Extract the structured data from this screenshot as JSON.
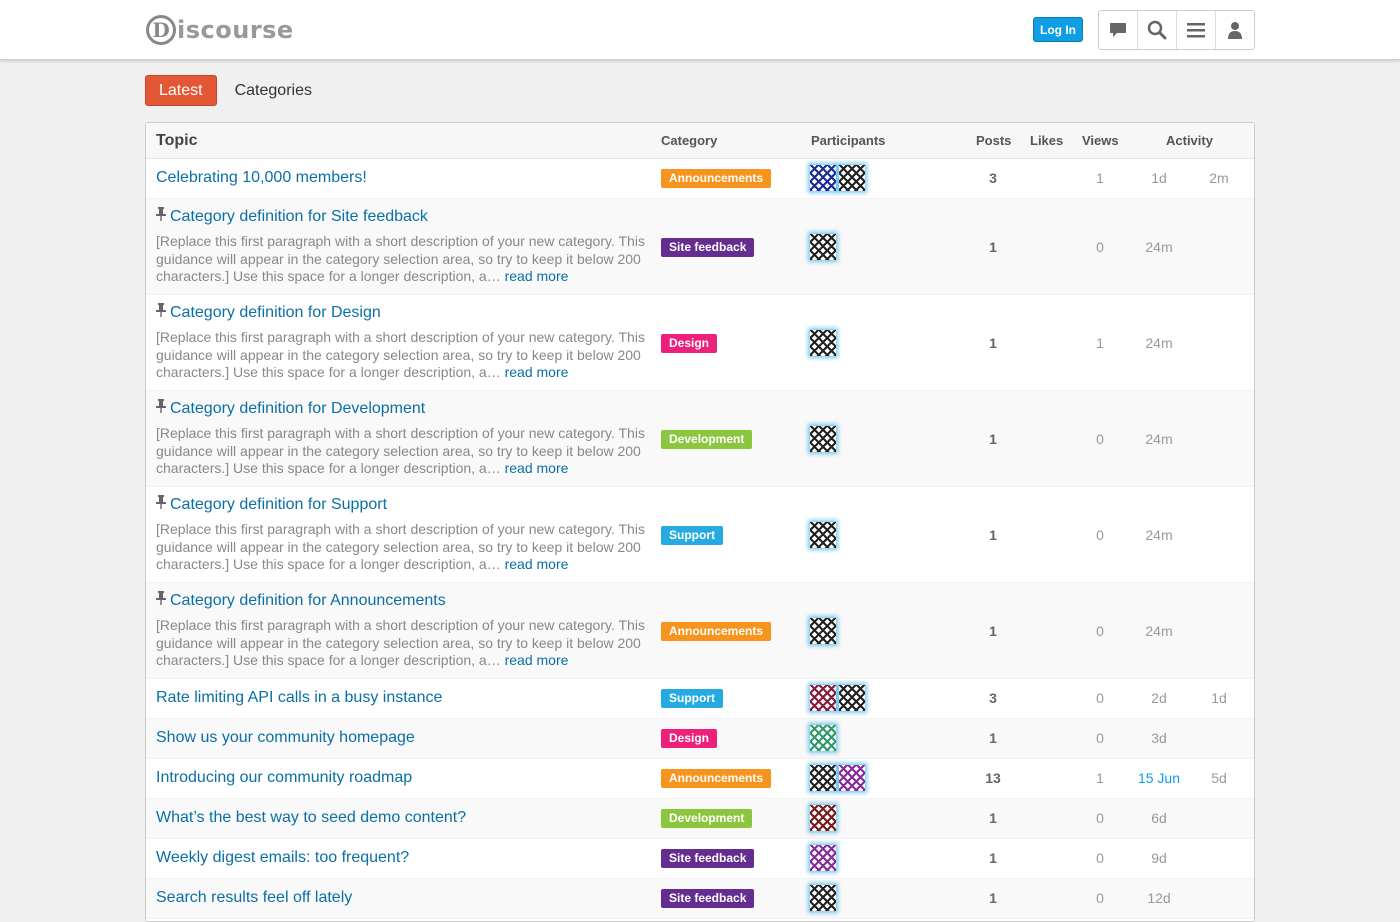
{
  "header": {
    "logo_text": "iscourse",
    "logo_letter": "D",
    "login_label": "Log In",
    "icons": [
      "chat-icon",
      "search-icon",
      "hamburger-menu-icon",
      "user-icon"
    ]
  },
  "nav": {
    "tabs": [
      "Latest",
      "Categories"
    ]
  },
  "columns": {
    "topic": "Topic",
    "category": "Category",
    "participants": "Participants",
    "posts": "Posts",
    "likes": "Likes",
    "views": "Views",
    "activity": "Activity"
  },
  "colors": {
    "Announcements": "#f7941d",
    "Site feedback": "#652d90",
    "Design": "#ed207b",
    "Development": "#8cc63f",
    "Support": "#25aae1"
  },
  "excerpt_text": "[Replace this first paragraph with a short description of your new category. This guidance will appear in the category selection area, so try to keep it below 200 characters.] Use this space for a longer description, a…",
  "read_more": "read more",
  "topics": [
    {
      "title": "Celebrating 10,000 members!",
      "pinned": false,
      "excerpt": false,
      "category": "Announcements",
      "avatars": [
        "#1a2a9a",
        "#222222"
      ],
      "posts": "3",
      "views": "1",
      "activity": "1d",
      "activity2": "2m"
    },
    {
      "title": "Category definition for Site feedback",
      "pinned": true,
      "excerpt": true,
      "category": "Site feedback",
      "avatars": [
        "#222222"
      ],
      "posts": "1",
      "views": "0",
      "activity": "24m",
      "activity2": ""
    },
    {
      "title": "Category definition for Design",
      "pinned": true,
      "excerpt": true,
      "category": "Design",
      "avatars": [
        "#222222"
      ],
      "posts": "1",
      "views": "1",
      "activity": "24m",
      "activity2": ""
    },
    {
      "title": "Category definition for Development",
      "pinned": true,
      "excerpt": true,
      "category": "Development",
      "avatars": [
        "#222222"
      ],
      "posts": "1",
      "views": "0",
      "activity": "24m",
      "activity2": ""
    },
    {
      "title": "Category definition for Support",
      "pinned": true,
      "excerpt": true,
      "category": "Support",
      "avatars": [
        "#222222"
      ],
      "posts": "1",
      "views": "0",
      "activity": "24m",
      "activity2": ""
    },
    {
      "title": "Category definition for Announcements",
      "pinned": true,
      "excerpt": true,
      "category": "Announcements",
      "avatars": [
        "#222222"
      ],
      "posts": "1",
      "views": "0",
      "activity": "24m",
      "activity2": ""
    },
    {
      "title": "Rate limiting API calls in a busy instance",
      "pinned": false,
      "excerpt": false,
      "category": "Support",
      "avatars": [
        "#8a1a3a",
        "#222222"
      ],
      "posts": "3",
      "views": "0",
      "activity": "2d",
      "activity2": "1d"
    },
    {
      "title": "Show us your community homepage",
      "pinned": false,
      "excerpt": false,
      "category": "Design",
      "avatars": [
        "#2e9a6a"
      ],
      "posts": "1",
      "views": "0",
      "activity": "3d",
      "activity2": ""
    },
    {
      "title": "Introducing our community roadmap",
      "pinned": false,
      "excerpt": false,
      "category": "Announcements",
      "avatars": [
        "#222222",
        "#8a2a9a"
      ],
      "posts": "13",
      "views": "1",
      "activity": "15 Jun",
      "activity2": "5d",
      "activity_highlight": true
    },
    {
      "title": "What’s the best way to seed demo content?",
      "pinned": false,
      "excerpt": false,
      "category": "Development",
      "avatars": [
        "#7a1a1a"
      ],
      "posts": "1",
      "views": "0",
      "activity": "6d",
      "activity2": ""
    },
    {
      "title": "Weekly digest emails: too frequent?",
      "pinned": false,
      "excerpt": false,
      "category": "Site feedback",
      "avatars": [
        "#8a2a9a"
      ],
      "posts": "1",
      "views": "0",
      "activity": "9d",
      "activity2": ""
    },
    {
      "title": "Search results feel off lately",
      "pinned": false,
      "excerpt": false,
      "category": "Site feedback",
      "avatars": [
        "#222222"
      ],
      "posts": "1",
      "views": "0",
      "activity": "12d",
      "activity2": ""
    }
  ]
}
